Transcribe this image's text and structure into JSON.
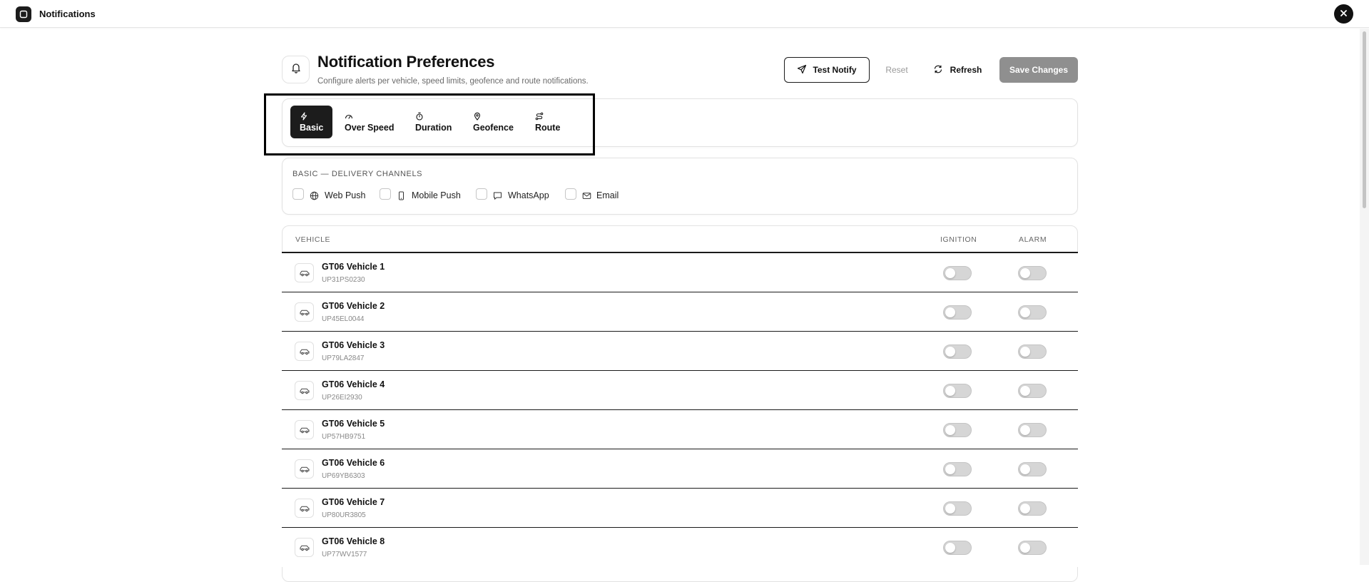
{
  "window": {
    "title": "Notifications",
    "app_icon": "square-icon",
    "close_icon": "close-icon"
  },
  "header": {
    "title": "Notification Preferences",
    "subtitle": "Configure alerts per vehicle, speed limits, geofence and route notifications.",
    "icon": "bell-icon"
  },
  "actions": {
    "test_notify": "Test Notify",
    "reset": "Reset",
    "refresh": "Refresh",
    "save": "Save Changes"
  },
  "tabs": [
    {
      "label": "Basic",
      "icon": "zap-icon",
      "active": true
    },
    {
      "label": "Over Speed",
      "icon": "gauge-icon",
      "active": false
    },
    {
      "label": "Duration",
      "icon": "timer-icon",
      "active": false
    },
    {
      "label": "Geofence",
      "icon": "map-pin-icon",
      "active": false
    },
    {
      "label": "Route",
      "icon": "route-icon",
      "active": false
    }
  ],
  "channels": {
    "heading": "BASIC — DELIVERY CHANNELS",
    "items": [
      {
        "label": "Web Push",
        "icon": "globe-icon",
        "checked": false
      },
      {
        "label": "Mobile Push",
        "icon": "smartphone-icon",
        "checked": false
      },
      {
        "label": "WhatsApp",
        "icon": "message-icon",
        "checked": false
      },
      {
        "label": "Email",
        "icon": "mail-icon",
        "checked": false
      }
    ]
  },
  "table": {
    "columns": [
      "VEHICLE",
      "IGNITION",
      "ALARM"
    ],
    "rows": [
      {
        "name": "GT06 Vehicle 1",
        "plate": "UP31PS0230",
        "ignition": false,
        "alarm": false
      },
      {
        "name": "GT06 Vehicle 2",
        "plate": "UP45EL0044",
        "ignition": false,
        "alarm": false
      },
      {
        "name": "GT06 Vehicle 3",
        "plate": "UP79LA2847",
        "ignition": false,
        "alarm": false
      },
      {
        "name": "GT06 Vehicle 4",
        "plate": "UP26EI2930",
        "ignition": false,
        "alarm": false
      },
      {
        "name": "GT06 Vehicle 5",
        "plate": "UP57HB9751",
        "ignition": false,
        "alarm": false
      },
      {
        "name": "GT06 Vehicle 6",
        "plate": "UP69YB6303",
        "ignition": false,
        "alarm": false
      },
      {
        "name": "GT06 Vehicle 7",
        "plate": "UP80UR3805",
        "ignition": false,
        "alarm": false
      },
      {
        "name": "GT06 Vehicle 8",
        "plate": "UP77WV1577",
        "ignition": false,
        "alarm": false
      }
    ]
  }
}
